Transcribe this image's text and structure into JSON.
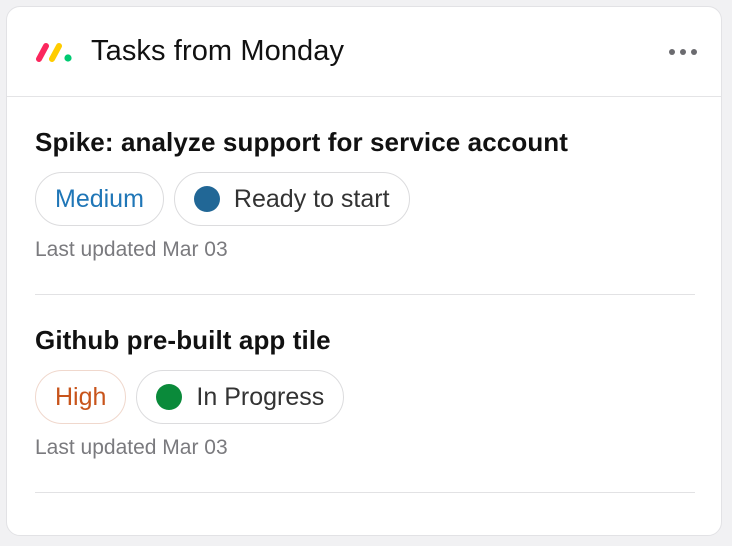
{
  "widget": {
    "title": "Tasks from Monday",
    "menu_icon": "more-horizontal-icon",
    "logo_icon": "monday-logo-icon"
  },
  "colors": {
    "medium": "#1f76b7",
    "high": "#c8541b",
    "ready_to_start": "#216796",
    "in_progress": "#0a8a3a",
    "logo": [
      "#fb275d",
      "#ffcc00",
      "#00ca72"
    ]
  },
  "tasks": [
    {
      "title": "Spike: analyze support for service account",
      "priority": "Medium",
      "status": "Ready to start",
      "updated": "Last updated Mar 03"
    },
    {
      "title": "Github pre-built app tile",
      "priority": "High",
      "status": "In Progress",
      "updated": "Last updated Mar 03"
    }
  ]
}
